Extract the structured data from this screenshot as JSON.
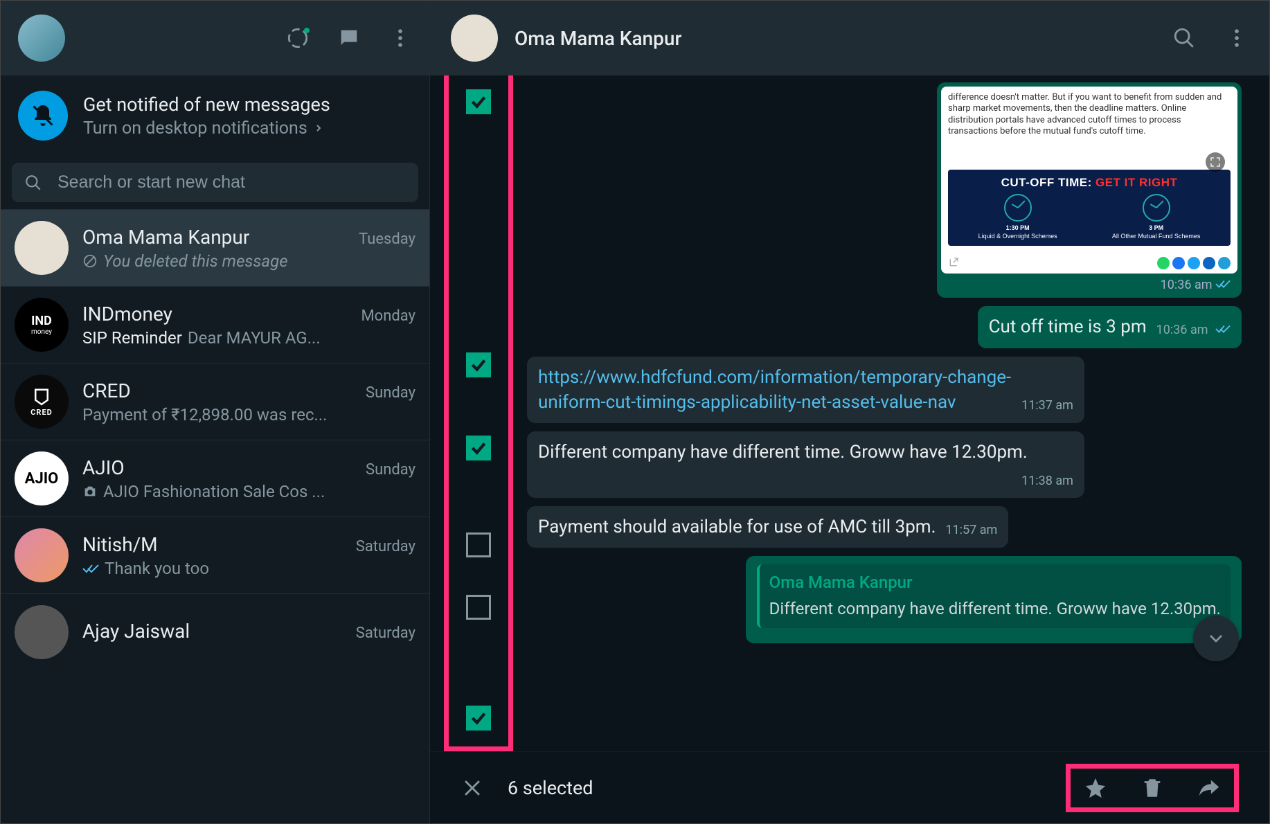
{
  "sidebar": {
    "notification": {
      "title": "Get notified of new messages",
      "subtitle": "Turn on desktop notifications"
    },
    "search_placeholder": "Search or start new chat",
    "chats": [
      {
        "name": "Oma Mama Kanpur",
        "date": "Tuesday",
        "preview": "You deleted this message",
        "deleted": true,
        "active": true,
        "avatar": "oma"
      },
      {
        "name": "INDmoney",
        "date": "Monday",
        "preview_bold": "SIP Reminder",
        "preview": " Dear MAYUR AG...",
        "avatar": "ind"
      },
      {
        "name": "CRED",
        "date": "Sunday",
        "preview": "Payment of ₹12,898.00 was rec...",
        "avatar": "cred"
      },
      {
        "name": "AJIO",
        "date": "Sunday",
        "preview": "AJIO Fashionation Sale  Cos ...",
        "has_image_icon": true,
        "avatar": "ajio"
      },
      {
        "name": "Nitish/M",
        "date": "Saturday",
        "preview": "Thank you too",
        "has_blue_tick": true,
        "avatar": "nitish"
      },
      {
        "name": "Ajay Jaiswal",
        "date": "Saturday",
        "preview": "",
        "avatar": "default"
      }
    ]
  },
  "chat": {
    "title": "Oma Mama Kanpur",
    "image_msg": {
      "blurb": "difference doesn't matter. But if you want to benefit from sudden and sharp market movements, then the deadline matters. Online distribution portals have advanced cutoff times to process transactions before the mutual fund's cutoff time.",
      "banner_title_a": "CUT-OFF TIME:",
      "banner_title_b": "GET IT RIGHT",
      "left_time": "1:30 PM",
      "left_label": "Liquid & Overnight Schemes",
      "right_time": "3 PM",
      "right_label": "All Other Mutual Fund Schemes",
      "time": "10:36 am"
    },
    "messages": [
      {
        "dir": "out",
        "text": "Cut off time is 3 pm",
        "time": "10:36 am",
        "ticks": true
      },
      {
        "dir": "in",
        "link": "https://www.hdfcfund.com/information/temporary-change-uniform-cut-timings-applicability-net-asset-value-nav",
        "time": "11:37 am"
      },
      {
        "dir": "in",
        "text": "Different company have different time. Groww have 12.30pm.",
        "time": "11:38 am"
      },
      {
        "dir": "in",
        "text": "Payment should available for use of AMC till 3pm.",
        "time": "11:57 am"
      },
      {
        "dir": "out",
        "quote_name": "Oma Mama Kanpur",
        "quote_text": "Different company have different time. Groww have 12.30pm."
      }
    ],
    "checkboxes": [
      true,
      true,
      true,
      false,
      false,
      true
    ],
    "checkbox_tops": [
      20,
      400,
      520,
      660,
      750,
      910
    ]
  },
  "selection_bar": {
    "count": "6 selected"
  }
}
